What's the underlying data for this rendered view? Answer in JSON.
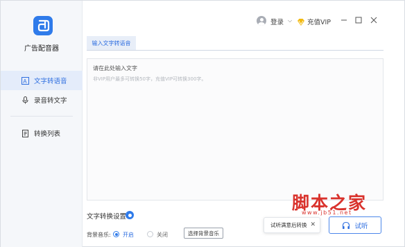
{
  "app": {
    "name": "广告配音器"
  },
  "sidebar": {
    "items": [
      {
        "label": "文字转语音",
        "icon": "text-a-icon",
        "active": true
      },
      {
        "label": "录音转文字",
        "icon": "microphone-icon",
        "active": false
      },
      {
        "label": "转换列表",
        "icon": "list-doc-icon",
        "active": false
      }
    ]
  },
  "topbar": {
    "login_label": "登录",
    "vip_label": "充值VIP"
  },
  "tabs": [
    {
      "label": "输入文字转语音",
      "active": true
    }
  ],
  "editor": {
    "placeholder": "请在此处输入文字",
    "hint": "非VIP用户最多可转换50字，充值VIP可转换300字。"
  },
  "settings": {
    "title": "文字转换设置",
    "bgm_label": "背景音乐:",
    "on_label": "开启",
    "off_label": "关闭",
    "bgm_selected": "开启",
    "pick_music_label": "选择背景音乐"
  },
  "toast": {
    "text": "试听满意后转换",
    "close": "✕"
  },
  "listen_button": {
    "label": "试听"
  },
  "watermark": {
    "text": "脚本之家",
    "url": "www.jb51.net"
  },
  "colors": {
    "accent": "#2f7bea",
    "watermark": "#d9322c"
  }
}
